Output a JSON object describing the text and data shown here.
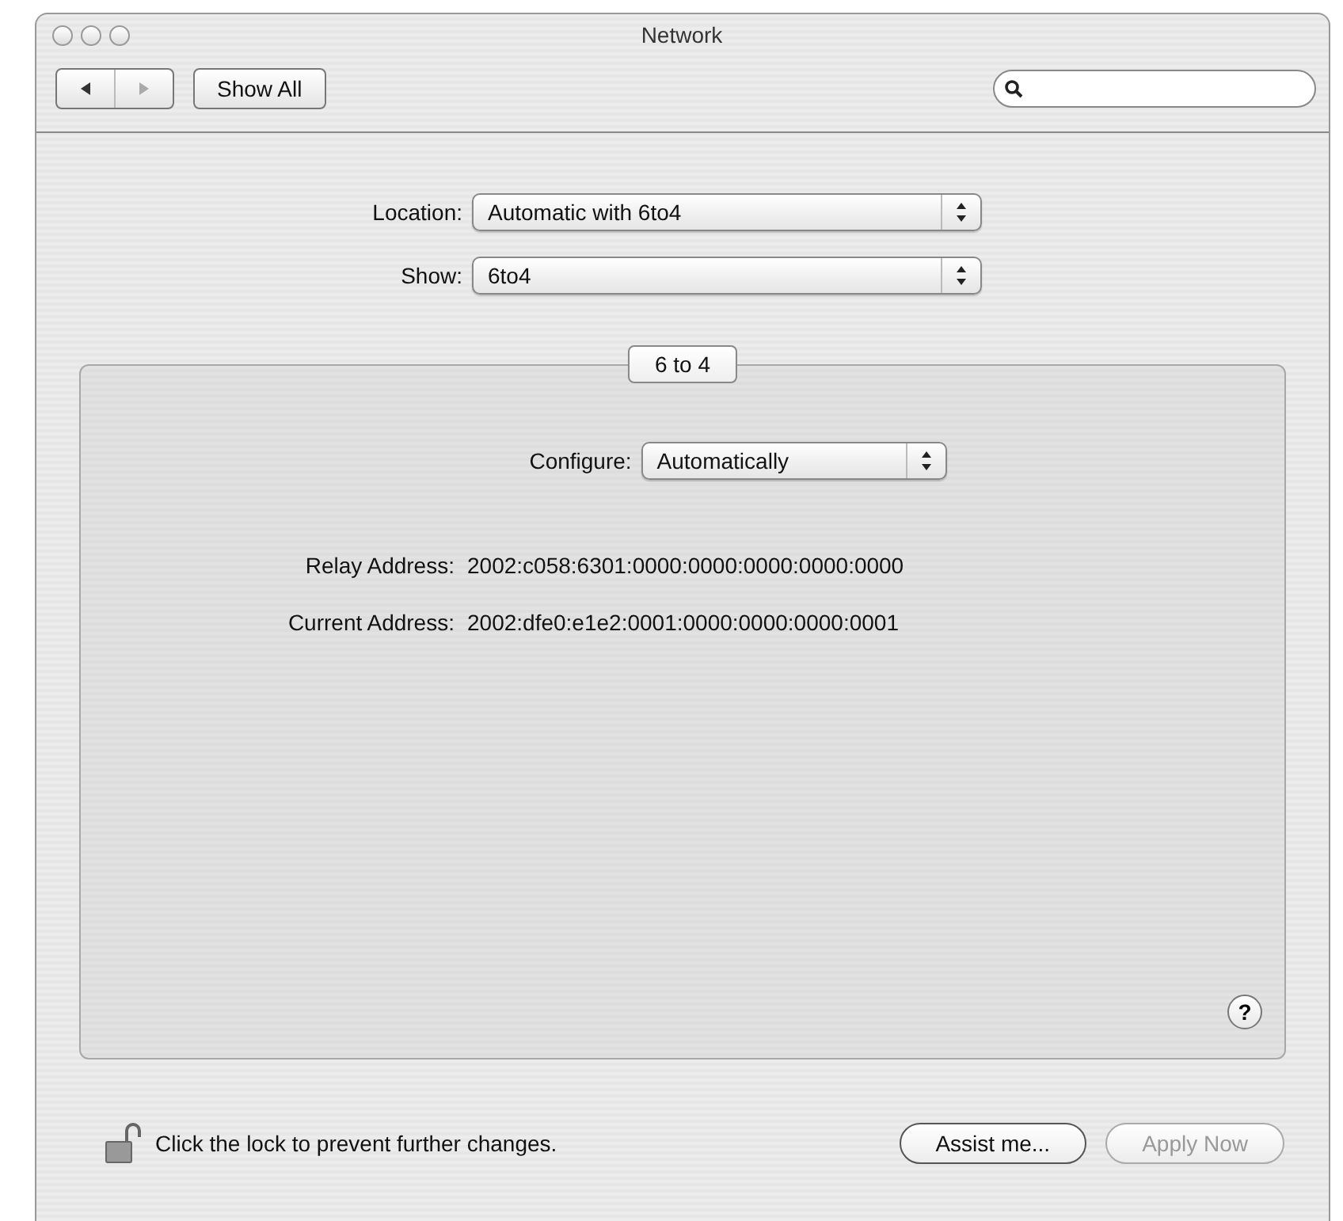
{
  "window": {
    "title": "Network"
  },
  "toolbar": {
    "nav_buttons": [
      {
        "kind": "back",
        "disabled": false
      },
      {
        "kind": "forward",
        "disabled": true
      }
    ],
    "show_all": "Show All"
  },
  "selectors": [
    {
      "label": "Location:",
      "value": "Automatic with 6to4"
    },
    {
      "label": "Show:",
      "value": "6to4"
    }
  ],
  "panel": {
    "tab": "6 to 4",
    "configure": {
      "label": "Configure:",
      "value": "Automatically"
    },
    "fields": [
      {
        "label": "Relay Address:",
        "value": "2002:c058:6301:0000:0000:0000:0000:0000"
      },
      {
        "label": "Current Address:",
        "value": "2002:dfe0:e1e2:0001:0000:0000:0000:0001"
      }
    ],
    "help": "?"
  },
  "lock": {
    "locked": false,
    "text": "Click the lock to prevent further changes."
  },
  "buttons": [
    {
      "label": "Assist me...",
      "disabled": false
    },
    {
      "label": "Apply Now",
      "disabled": true
    }
  ]
}
